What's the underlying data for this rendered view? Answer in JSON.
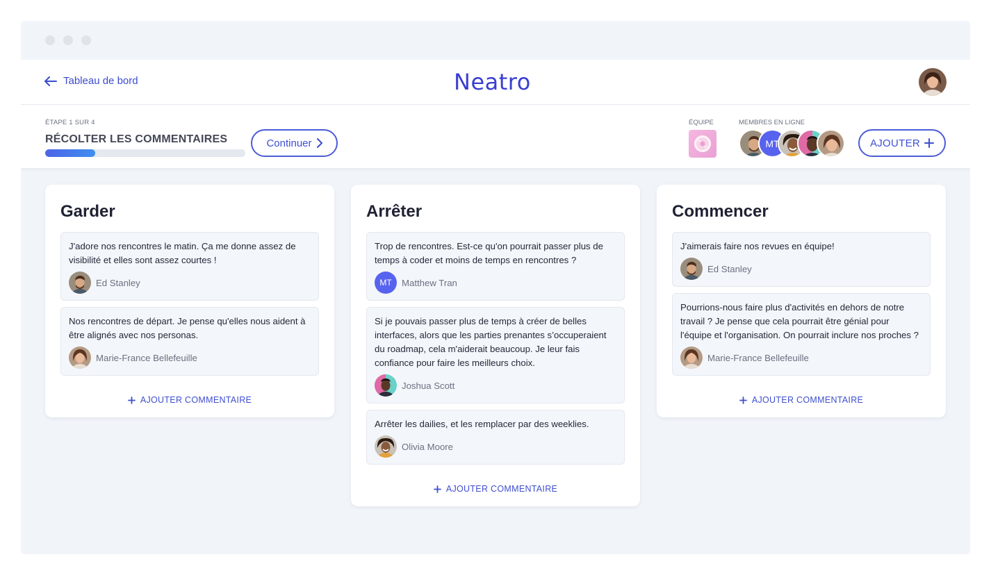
{
  "header": {
    "back_label": "Tableau de bord",
    "logo": "Neatro"
  },
  "step": {
    "counter": "ÉTAPE 1 SUR 4",
    "title": "RÉCOLTER LES COMMENTAIRES",
    "progress_fraction": 0.25,
    "continue_label": "Continuer"
  },
  "team": {
    "team_label": "ÉQUIPE",
    "members_label": "MEMBRES EN LIGNE",
    "member_initials": "MT",
    "add_label": "AJOUTER"
  },
  "columns": [
    {
      "title": "Garder",
      "add_label": "AJOUTER COMMENTAIRE",
      "cards": [
        {
          "text": "J'adore nos rencontres le matin. Ça me donne assez de visibilité et elles sont assez courtes !",
          "author": "Ed Stanley"
        },
        {
          "text": "Nos rencontres de départ. Je pense qu'elles nous aident à être alignés avec nos personas.",
          "author": "Marie-France Bellefeuille"
        }
      ]
    },
    {
      "title": "Arrêter",
      "add_label": "AJOUTER COMMENTAIRE",
      "cards": [
        {
          "text": "Trop de rencontres. Est-ce qu'on pourrait passer plus de temps à coder et moins de temps en rencontres ?",
          "author": "Matthew Tran",
          "initials": "MT"
        },
        {
          "text": "Si je pouvais passer plus de temps à créer de belles interfaces, alors que les parties prenantes s’occuperaient du roadmap, cela m'aiderait beaucoup. Je leur fais confiance pour faire les meilleurs choix.",
          "author": "Joshua Scott"
        },
        {
          "text": "Arrêter les dailies, et les remplacer par des weeklies.",
          "author": "Olivia Moore"
        }
      ]
    },
    {
      "title": "Commencer",
      "add_label": "AJOUTER COMMENTAIRE",
      "cards": [
        {
          "text": "J'aimerais faire nos revues en équipe!",
          "author": "Ed Stanley"
        },
        {
          "text": "Pourrions-nous faire plus d'activités en dehors de notre travail ? Je pense que cela pourrait être génial pour l'équipe et l'organisation. On pourrait  inclure nos proches ?",
          "author": "Marie-France Bellefeuille"
        }
      ]
    }
  ],
  "colors": {
    "accent": "#3e4ed0",
    "logo": "#3a3fd0",
    "avatar_initials_bg": "#5763ef",
    "background": "#f1f5f9"
  }
}
